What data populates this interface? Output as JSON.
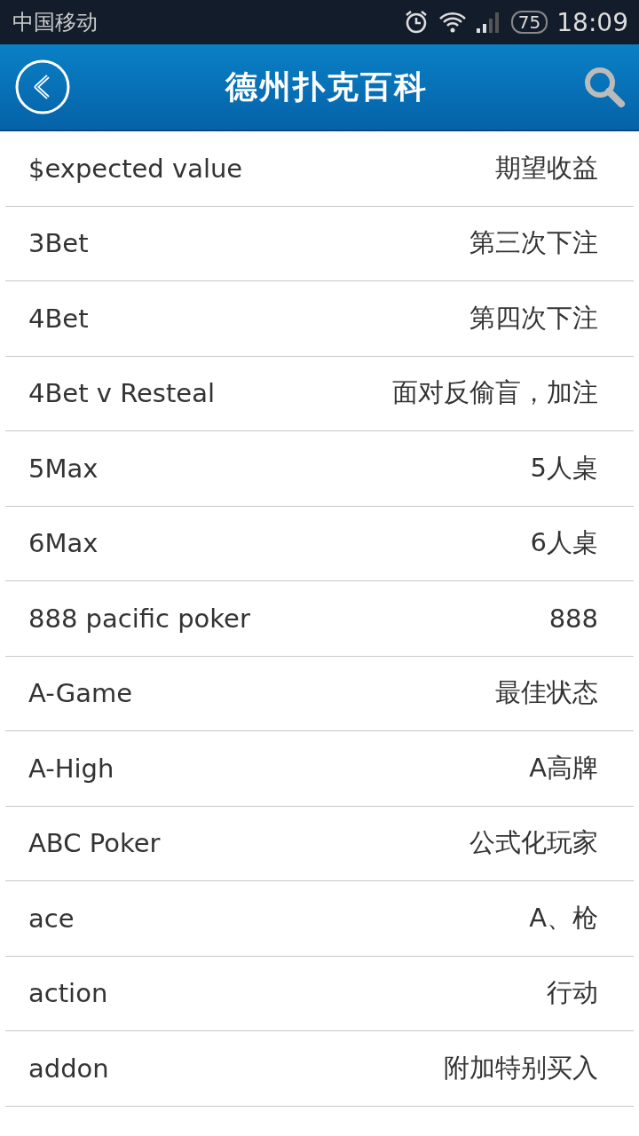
{
  "status_bar": {
    "carrier": "中国移动",
    "battery": "75",
    "time": "18:09"
  },
  "header": {
    "title": "德州扑克百科"
  },
  "entries": [
    {
      "term": "$expected value",
      "meaning": "期望收益"
    },
    {
      "term": "3Bet",
      "meaning": "第三次下注"
    },
    {
      "term": "4Bet",
      "meaning": "第四次下注"
    },
    {
      "term": "4Bet v Resteal",
      "meaning": "面对反偷盲，加注"
    },
    {
      "term": "5Max",
      "meaning": "5人桌"
    },
    {
      "term": "6Max",
      "meaning": "6人桌"
    },
    {
      "term": "888 pacific poker",
      "meaning": "888"
    },
    {
      "term": "A-Game",
      "meaning": "最佳状态"
    },
    {
      "term": "A-High",
      "meaning": "A高牌"
    },
    {
      "term": "ABC Poker",
      "meaning": "公式化玩家"
    },
    {
      "term": "ace",
      "meaning": "A、枪"
    },
    {
      "term": "action",
      "meaning": "行动"
    },
    {
      "term": "addon",
      "meaning": "附加特别买入"
    }
  ]
}
